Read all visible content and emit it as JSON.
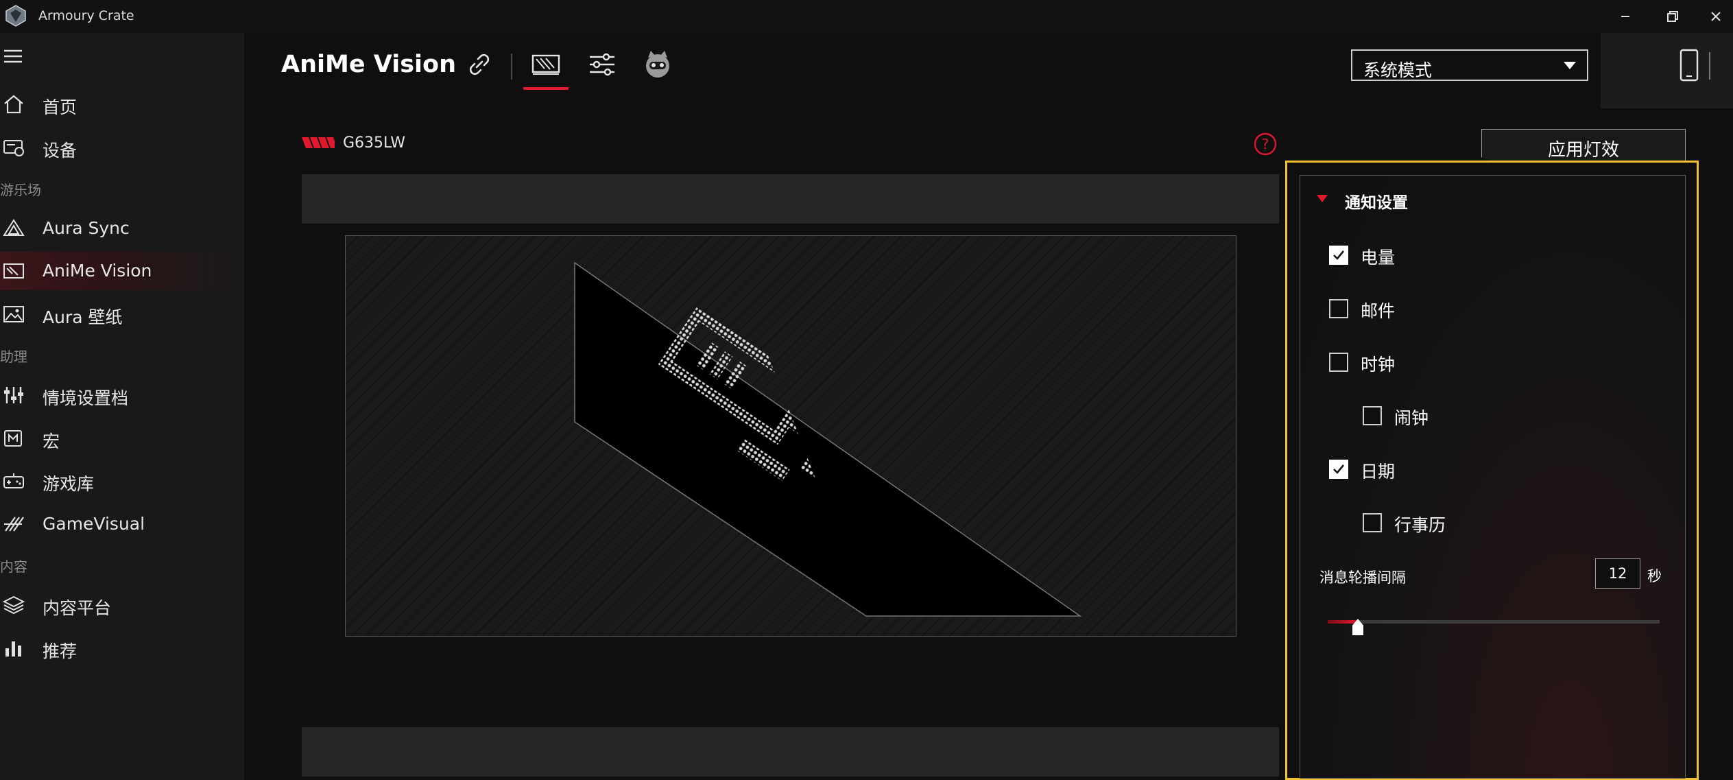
{
  "window": {
    "title": "Armoury Crate",
    "controls": [
      "minimize",
      "restore",
      "close"
    ]
  },
  "sidebar": {
    "items": [
      {
        "label": "首页",
        "icon": "home-icon",
        "active": false
      },
      {
        "label": "设备",
        "icon": "device-icon",
        "active": false
      },
      {
        "section": "游乐场"
      },
      {
        "label": "Aura Sync",
        "icon": "aura-sync-icon",
        "active": false
      },
      {
        "label": "AniMe Vision",
        "icon": "anime-vision-icon",
        "active": true
      },
      {
        "label": "Aura 壁纸",
        "icon": "wallpaper-icon",
        "active": false
      },
      {
        "section": "助理"
      },
      {
        "label": "情境设置档",
        "icon": "scenario-profiles-icon",
        "active": false
      },
      {
        "label": "宏",
        "icon": "macro-icon",
        "active": false
      },
      {
        "label": "游戏库",
        "icon": "game-library-icon",
        "active": false
      },
      {
        "label": "GameVisual",
        "icon": "gamevisual-icon",
        "active": false
      },
      {
        "section": "内容"
      },
      {
        "label": "内容平台",
        "icon": "content-platform-icon",
        "active": false
      },
      {
        "label": "推荐",
        "icon": "recommend-icon",
        "active": false
      }
    ]
  },
  "header": {
    "title": "AniMe Vision",
    "tabs": [
      {
        "icon": "link-icon",
        "active": false
      },
      {
        "icon": "anime-matrix-icon",
        "active": true
      },
      {
        "icon": "sliders-icon",
        "active": false
      },
      {
        "icon": "mascot-icon",
        "active": false
      }
    ],
    "mode_select": {
      "value": "系统模式"
    }
  },
  "device": {
    "name": "G635LW"
  },
  "apply_button": {
    "label": "应用灯效"
  },
  "notification_settings": {
    "title": "通知设置",
    "options": [
      {
        "label": "电量",
        "checked": true
      },
      {
        "label": "邮件",
        "checked": false
      },
      {
        "label": "时钟",
        "checked": false
      },
      {
        "label": "闹钟",
        "checked": false
      },
      {
        "label": "日期",
        "checked": true
      },
      {
        "label": "行事历",
        "checked": false
      }
    ],
    "interval": {
      "label": "消息轮播间隔",
      "value": "12",
      "unit": "秒",
      "slider_fraction": 0.09
    }
  },
  "colors": {
    "accent": "#e0192f",
    "highlight": "#f2c230",
    "sidebar_bg": "#191919",
    "content_bg": "#0f0f0f"
  }
}
